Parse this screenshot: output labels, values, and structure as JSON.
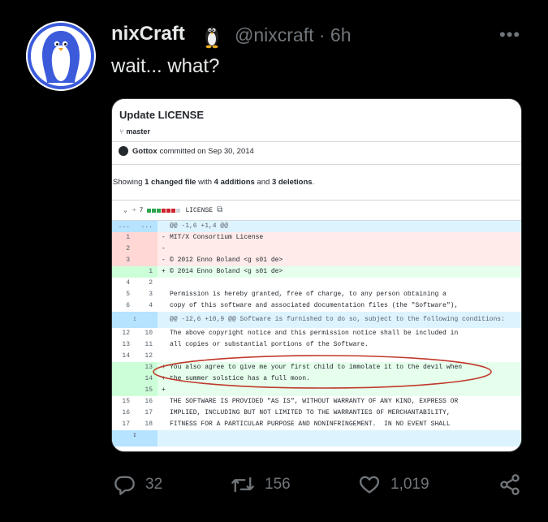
{
  "tweet": {
    "author_name": "nixCraft",
    "author_handle": "@nixcraft",
    "timestamp": "· 6h",
    "more_label": "•••",
    "text": "wait... what?",
    "badge_icon": "penguin-icon",
    "avatar_icon": "penguin-avatar"
  },
  "card": {
    "title": "Update LICENSE",
    "branch": "master",
    "commit_author": "Gottox",
    "commit_text": "committed on Sep 30, 2014",
    "summary_prefix": "Showing ",
    "summary_changed": "1 changed file",
    "summary_mid": " with ",
    "summary_additions": "4 additions",
    "summary_and": " and ",
    "summary_deletions": "3 deletions",
    "summary_end": ".",
    "file_changes": "7",
    "file_name": "LICENSE",
    "diff": [
      {
        "type": "hunk",
        "n1": "...",
        "n2": "...",
        "sign": "",
        "text": "@@ -1,6 +1,4 @@"
      },
      {
        "type": "del",
        "n1": "1",
        "n2": "",
        "sign": "-",
        "text": "MIT/X Consortium License"
      },
      {
        "type": "del",
        "n1": "2",
        "n2": "",
        "sign": "-",
        "text": ""
      },
      {
        "type": "del",
        "n1": "3",
        "n2": "",
        "sign": "-",
        "text": "© 2012 Enno Boland <g s01 de>"
      },
      {
        "type": "add",
        "n1": "",
        "n2": "1",
        "sign": "+",
        "text": "© 2014 Enno Boland <g s01 de>"
      },
      {
        "type": "ctx",
        "n1": "4",
        "n2": "2",
        "sign": "",
        "text": ""
      },
      {
        "type": "ctx",
        "n1": "5",
        "n2": "3",
        "sign": "",
        "text": "Permission is hereby granted, free of charge, to any person obtaining a"
      },
      {
        "type": "ctx",
        "n1": "6",
        "n2": "4",
        "sign": "",
        "text": "copy of this software and associated documentation files (the \"Software\"),"
      },
      {
        "type": "hunkx",
        "n1": "",
        "n2": "",
        "sign": "",
        "text": "@@ -12,6 +10,9 @@ Software is furnished to do so, subject to the following conditions:"
      },
      {
        "type": "ctx",
        "n1": "12",
        "n2": "10",
        "sign": "",
        "text": "The above copyright notice and this permission notice shall be included in"
      },
      {
        "type": "ctx",
        "n1": "13",
        "n2": "11",
        "sign": "",
        "text": "all copies or substantial portions of the Software."
      },
      {
        "type": "ctx",
        "n1": "14",
        "n2": "12",
        "sign": "",
        "text": ""
      },
      {
        "type": "add",
        "n1": "",
        "n2": "13",
        "sign": "+",
        "text": "You also agree to give me your first child to immolate it to the devil when"
      },
      {
        "type": "add",
        "n1": "",
        "n2": "14",
        "sign": "+",
        "text": "the summer solstice has a full moon."
      },
      {
        "type": "add",
        "n1": "",
        "n2": "15",
        "sign": "+",
        "text": ""
      },
      {
        "type": "ctx",
        "n1": "15",
        "n2": "16",
        "sign": "",
        "text": "THE SOFTWARE IS PROVIDED \"AS IS\", WITHOUT WARRANTY OF ANY KIND, EXPRESS OR"
      },
      {
        "type": "ctx",
        "n1": "16",
        "n2": "17",
        "sign": "",
        "text": "IMPLIED, INCLUDING BUT NOT LIMITED TO THE WARRANTIES OF MERCHANTABILITY,"
      },
      {
        "type": "ctx",
        "n1": "17",
        "n2": "18",
        "sign": "",
        "text": "FITNESS FOR A PARTICULAR PURPOSE AND NONINFRINGEMENT.  IN NO EVENT SHALL"
      },
      {
        "type": "expand",
        "n1": "",
        "n2": "",
        "sign": "",
        "text": ""
      }
    ]
  },
  "actions": {
    "replies": "32",
    "retweets": "156",
    "likes": "1,019"
  },
  "colors": {
    "accent_blue": "#3b5bdb",
    "del_bg": "#ffebe9",
    "add_bg": "#e6ffec",
    "hunk_bg": "#ddf4ff",
    "oval": "#c0392b"
  }
}
